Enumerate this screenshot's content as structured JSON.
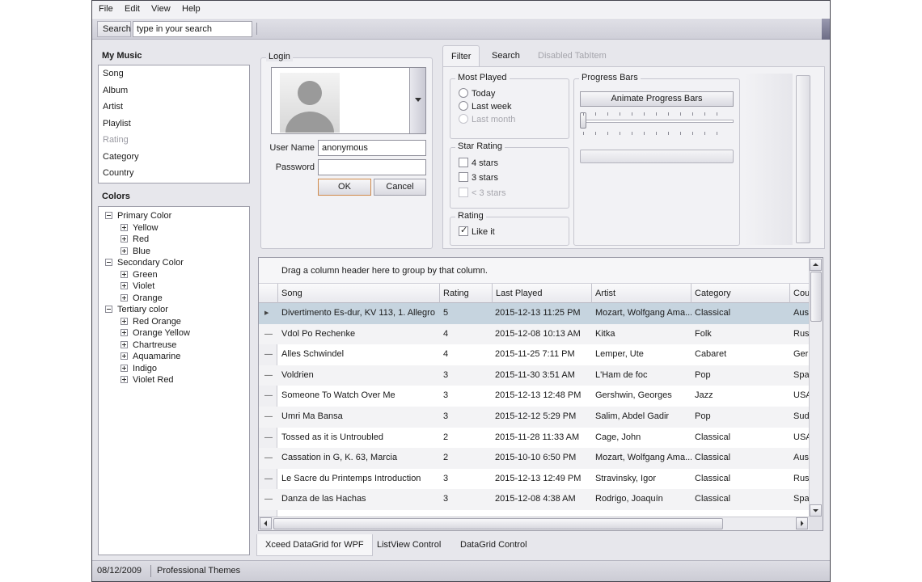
{
  "menu": {
    "items": [
      "File",
      "Edit",
      "View",
      "Help"
    ]
  },
  "toolbar": {
    "search_label": "Search",
    "search_value": "type in your search"
  },
  "my_music": {
    "title": "My Music",
    "items": [
      "Song",
      "Album",
      "Artist",
      "Playlist",
      "Rating",
      "Category",
      "Country"
    ],
    "disabled_item": "Rating"
  },
  "colors": {
    "title": "Colors",
    "tree": [
      {
        "label": "Primary Color",
        "children": [
          "Yellow",
          "Red",
          "Blue"
        ]
      },
      {
        "label": "Secondary Color",
        "children": [
          "Green",
          "Violet",
          "Orange"
        ]
      },
      {
        "label": "Tertiary color",
        "children": [
          "Red Orange",
          "Orange Yellow",
          "Chartreuse",
          "Aquamarine",
          "Indigo",
          "Violet Red"
        ]
      }
    ]
  },
  "login": {
    "title": "Login",
    "username_label": "User Name",
    "username_value": "anonymous",
    "password_label": "Password",
    "password_value": "",
    "ok_label": "OK",
    "cancel_label": "Cancel"
  },
  "tabs": {
    "items": [
      "Filter",
      "Search",
      "Disabled TabItem"
    ],
    "selected": "Filter"
  },
  "filter": {
    "most_played": {
      "title": "Most Played",
      "options": [
        "Today",
        "Last week",
        "Last month"
      ]
    },
    "star_rating": {
      "title": "Star Rating",
      "options": [
        "4 stars",
        "3 stars",
        "< 3 stars"
      ]
    },
    "rating": {
      "title": "Rating",
      "option": "Like it",
      "checked": true
    },
    "progress": {
      "title": "Progress Bars",
      "button_label": "Animate Progress Bars",
      "slider_value": 0,
      "progress_value": 0
    }
  },
  "grid": {
    "group_hint": "Drag a column header here to group by that column.",
    "columns": [
      "Song",
      "Rating",
      "Last Played",
      "Artist",
      "Category",
      "Cou"
    ],
    "rows": [
      [
        "Divertimento Es-dur, KV 113, 1. Allegro",
        "5",
        "2015-12-13 11:25 PM",
        "Mozart, Wolfgang Ama...",
        "Classical",
        "Aus"
      ],
      [
        "Vdol Po Rechenke",
        "4",
        "2015-12-08 10:13 AM",
        "Kitka",
        "Folk",
        "Rus"
      ],
      [
        "Alles Schwindel",
        "4",
        "2015-11-25 7:11 PM",
        "Lemper, Ute",
        "Cabaret",
        "Ger"
      ],
      [
        "Voldrien",
        "3",
        "2015-11-30 3:51 AM",
        "L'Ham de foc",
        "Pop",
        "Spa"
      ],
      [
        "Someone To Watch Over Me",
        "3",
        "2015-12-13 12:48 PM",
        "Gershwin, Georges",
        "Jazz",
        "USA"
      ],
      [
        "Umri Ma Bansa",
        "3",
        "2015-12-12 5:29 PM",
        "Salim, Abdel Gadir",
        "Pop",
        "Sud"
      ],
      [
        "Tossed as it is Untroubled",
        "2",
        "2015-11-28 11:33 AM",
        "Cage, John",
        "Classical",
        "USA"
      ],
      [
        "Cassation in G, K. 63, Marcia",
        "2",
        "2015-10-10 6:50 PM",
        "Mozart, Wolfgang Ama...",
        "Classical",
        "Aus"
      ],
      [
        "Le Sacre du Printemps Introduction",
        "3",
        "2015-12-13 12:49 PM",
        "Stravinsky, Igor",
        "Classical",
        "Rus"
      ],
      [
        "Danza de las Hachas",
        "3",
        "2015-12-08 4:38 AM",
        "Rodrigo, Joaquín",
        "Classical",
        "Spa"
      ]
    ],
    "selected_row": 0
  },
  "bottom_tabs": {
    "items": [
      "Xceed DataGrid for WPF",
      "ListView Control",
      "DataGrid Control"
    ],
    "selected": "Xceed DataGrid for WPF"
  },
  "status": {
    "date": "08/12/2009",
    "theme": "Professional Themes"
  }
}
